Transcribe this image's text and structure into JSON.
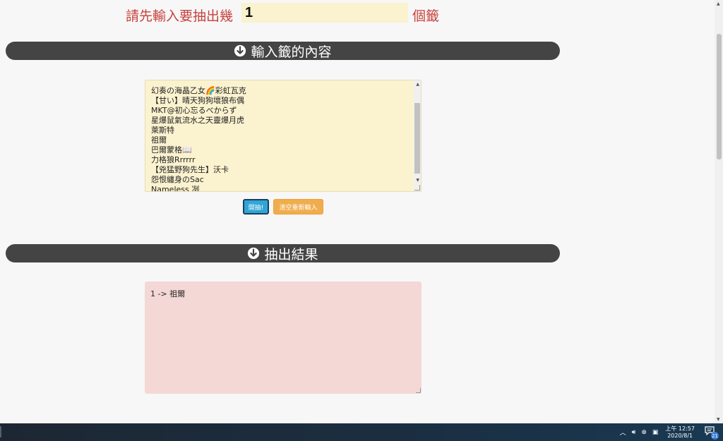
{
  "prompt": {
    "left_label": "請先輸入要抽出幾",
    "count_value": "1",
    "right_label": "個籤"
  },
  "sections": {
    "input_title": "輸入籤的內容",
    "result_title": "抽出結果"
  },
  "entries": [
    "",
    "幻奏の海晶乙女🌈彩虹瓦克",
    "【甘い】晴天狗狗壞狼布偶",
    "MKT@初心忘るべからず",
    "星爆鼠氣流水之天靈爆月虎",
    "萊斯特",
    "祖爾",
    "巴爾蒙格📖",
    "力格狼Rrrrrr",
    "【兇猛野狗先生】沃卡",
    "怨恨纏身のSac",
    "Nameless 冽"
  ],
  "buttons": {
    "draw": "開抽!",
    "clear": "清空重新輸入"
  },
  "result": {
    "text": "1 -> 祖爾"
  },
  "taskbar": {
    "clock_time": "上午 12:57",
    "clock_date": "2020/8/1",
    "notification_count": "21"
  },
  "colors": {
    "label_red": "#c8413b",
    "bar_dark": "#444444",
    "input_yellow": "#fbf2cf",
    "result_pink": "#f3d8d5",
    "draw_blue": "#2fa6d5",
    "clear_orange": "#f0ad4e"
  }
}
